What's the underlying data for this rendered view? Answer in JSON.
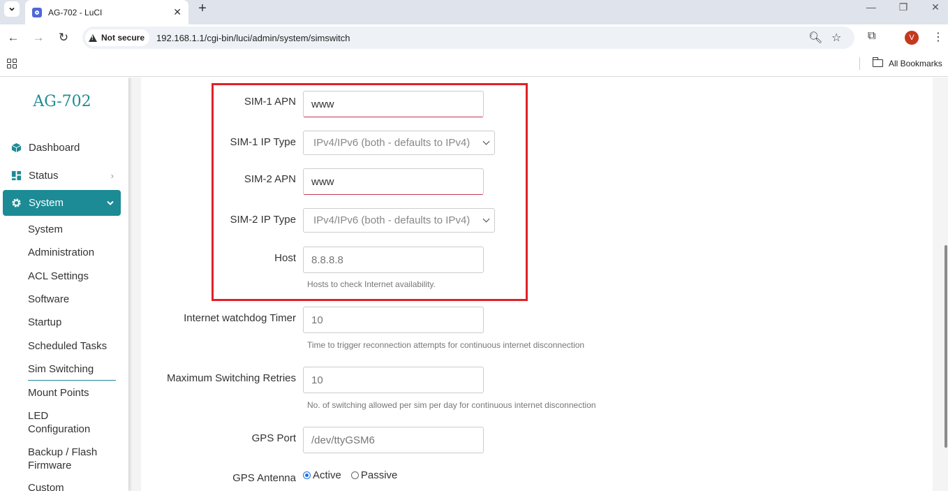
{
  "browser": {
    "tab_title": "AG-702 - LuCI",
    "security_label": "Not secure",
    "url": "192.168.1.1/cgi-bin/luci/admin/system/simswitch",
    "profile_initial": "V",
    "bookmarks_label": "All Bookmarks"
  },
  "sidebar": {
    "brand": "AG-702",
    "menu": {
      "dashboard": "Dashboard",
      "status": "Status",
      "system": "System"
    },
    "submenu": [
      "System",
      "Administration",
      "ACL Settings",
      "Software",
      "Startup",
      "Scheduled Tasks",
      "Sim Switching",
      "Mount Points",
      "LED Configuration",
      "Backup / Flash Firmware",
      "Custom"
    ]
  },
  "form": {
    "sim1_apn": {
      "label": "SIM-1 APN",
      "value": "www"
    },
    "sim1_ip_type": {
      "label": "SIM-1 IP Type",
      "value": "IPv4/IPv6 (both - defaults to IPv4)"
    },
    "sim2_apn": {
      "label": "SIM-2 APN",
      "value": "www"
    },
    "sim2_ip_type": {
      "label": "SIM-2 IP Type",
      "value": "IPv4/IPv6 (both - defaults to IPv4)"
    },
    "host": {
      "label": "Host",
      "placeholder": "8.8.8.8",
      "hint": "Hosts to check Internet availability."
    },
    "watchdog": {
      "label": "Internet watchdog Timer",
      "placeholder": "10",
      "hint": "Time to trigger reconnection attempts for continuous internet disconnection"
    },
    "max_retries": {
      "label": "Maximum Switching Retries",
      "placeholder": "10",
      "hint": "No. of switching allowed per sim per day for continuous internet disconnection"
    },
    "gps_port": {
      "label": "GPS Port",
      "placeholder": "/dev/ttyGSM6"
    },
    "gps_antenna": {
      "label": "GPS Antenna",
      "options": [
        "Active",
        "Passive"
      ],
      "selected": "Active"
    }
  },
  "colors": {
    "accent": "#1c8b95",
    "highlight": "#e02127"
  }
}
